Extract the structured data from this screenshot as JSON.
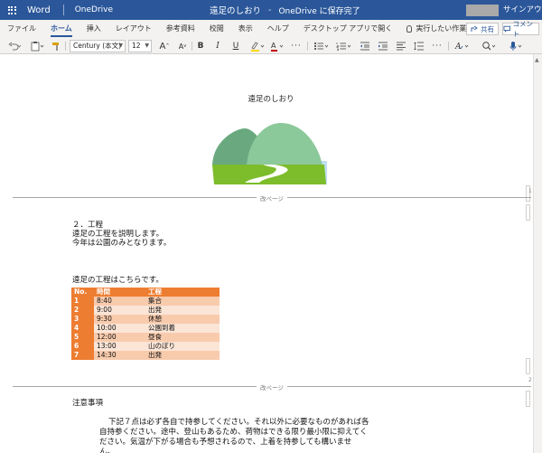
{
  "titlebar": {
    "app_name": "Word",
    "location": "OneDrive",
    "doc_title": "遠足のしおり",
    "dash": "-",
    "save_status": "OneDrive に保存完了",
    "signin": "サインアウト"
  },
  "tabs": [
    {
      "label": "ファイル"
    },
    {
      "label": "ホーム",
      "active": true
    },
    {
      "label": "挿入"
    },
    {
      "label": "レイアウト"
    },
    {
      "label": "参考資料"
    },
    {
      "label": "校閲"
    },
    {
      "label": "表示"
    },
    {
      "label": "ヘルプ"
    },
    {
      "label": "デスクトップ アプリで開く"
    }
  ],
  "tell_me": "実行したい作業を入力",
  "share_label": "共有",
  "comment_label": "コメント",
  "ribbon": {
    "font_name": "Century (本文)",
    "font_size": "12",
    "grow": "A",
    "shrink": "A",
    "bold": "B",
    "italic": "I",
    "underline": "U",
    "more": "···",
    "font_color_glyph": "A",
    "styles_glyph": "A",
    "accent_color": "#2b579a",
    "highlight_color": "#ffd800",
    "font_color": "#c00000"
  },
  "page_break_label": "改ページ",
  "margin_numbers": [
    "1",
    "2"
  ],
  "document": {
    "title": "遠足のしおり",
    "section_heading": "２．工程",
    "intro_lines": [
      "遠足の工程を説明します。",
      "今年は公園のみとなります。"
    ],
    "table_caption": "遠足の工程はこちらです。",
    "table_headers": [
      "No.",
      "時間",
      "工程"
    ],
    "table_rows": [
      [
        "1",
        "8:40",
        "集合"
      ],
      [
        "2",
        "9:00",
        "出発"
      ],
      [
        "3",
        "9:30",
        "休憩"
      ],
      [
        "4",
        "10:00",
        "公園到着"
      ],
      [
        "5",
        "12:00",
        "昼食"
      ],
      [
        "6",
        "13:00",
        "山のぼり"
      ],
      [
        "7",
        "14:30",
        "出発"
      ]
    ],
    "notes_heading": "注意事項",
    "notes_lines": [
      "下記７点は必ず各自で持参してください。それ以外に必要なものがあれば各",
      "自持参ください。途中、登山もあるため、荷物はできる限り最小限に抑えてく",
      "ださい。気温が下がる場合も予想されるので、上着を持参しても構いませ",
      "ん。"
    ]
  },
  "colors": {
    "titlebar_bg": "#2b579a",
    "table_header": "#ed7d31",
    "table_band_dark": "#f8cbad",
    "table_band_light": "#fbe5d6"
  }
}
